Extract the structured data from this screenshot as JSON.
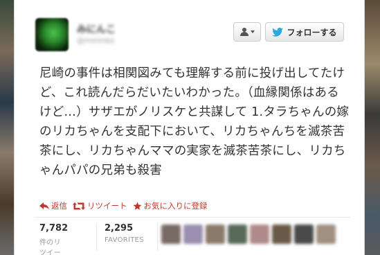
{
  "profile": {
    "name": "みにんこ",
    "handle": "@mininko"
  },
  "buttons": {
    "user_menu_icon": "person-icon",
    "follow_label": "フォローする",
    "follow_icon": "twitter-bird-icon"
  },
  "tweet": {
    "text": "尼崎の事件は相関図みても理解する前に投げ出してたけど、これ読んだらだいたいわかった。（血縁関係はあるけど…）サザエがノリスケと共謀して 1.タラちゃんの嫁のリカちゃんを支配下において、リカちゃんちを滅茶苦茶にし、リカちゃんママの実家を滅茶苦茶にし、リカちゃんパパの兄弟も殺害"
  },
  "actions": {
    "reply_label": "返信",
    "retweet_label": "リツイート",
    "favorite_label": "お気に入りに登録"
  },
  "stats": {
    "retweets_count": "7,782",
    "retweets_label": "件のリツイート",
    "favorites_count": "2,295",
    "favorites_label": "FAVORITES"
  },
  "favoriters": [
    {
      "color": "#7a6a66"
    },
    {
      "color": "#9a8fb0"
    },
    {
      "color": "#8a7a6a"
    },
    {
      "color": "#5a6a5a"
    },
    {
      "color": "#b08a8a"
    },
    {
      "color": "#6a5a4a"
    },
    {
      "color": "#4a4a4a"
    },
    {
      "color": "#a09080"
    }
  ],
  "colors": {
    "action_red": "#c0392b",
    "twitter_blue": "#2aa9e0"
  }
}
